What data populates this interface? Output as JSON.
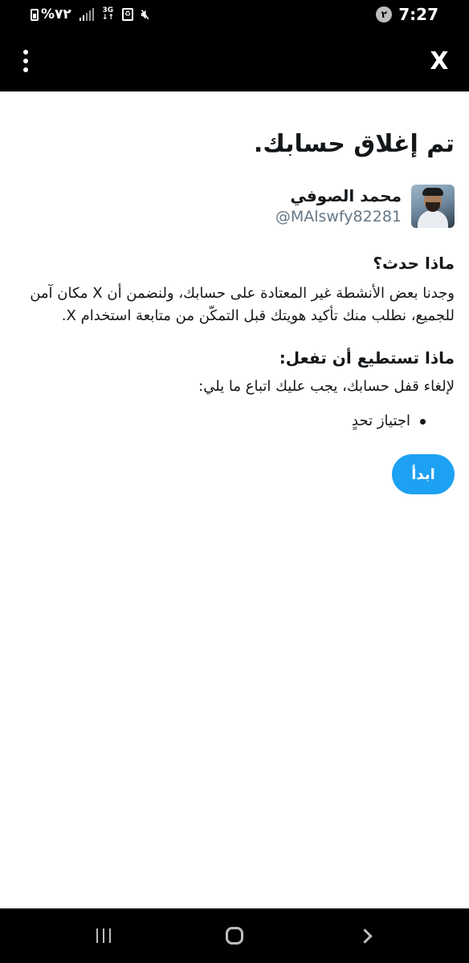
{
  "status_bar": {
    "battery_percent": "%٧٢",
    "network_label": "3G",
    "network_arrows": "↓↑",
    "notification_badge": "٢",
    "time": "7:27",
    "icons": [
      "battery-icon",
      "signal-icon",
      "network-3g-icon",
      "recycle-icon",
      "mute-icon",
      "notification-badge"
    ]
  },
  "header": {
    "menu_icon": "more-vertical-icon",
    "close_label": "X"
  },
  "main": {
    "title": "تم إغلاق حسابك.",
    "user": {
      "name": "محمد الصوفي",
      "handle": "@MAlswfy82281"
    },
    "what_happened": {
      "heading": "ماذا حدث؟",
      "text": "وجدنا بعض الأنشطة غير المعتادة على حسابك، ولنضمن أن X مكان آمن للجميع، نطلب منك تأكيد هويتك قبل التمكّن من متابعة استخدام X."
    },
    "what_you_can_do": {
      "heading": "ماذا تستطيع أن تفعل:",
      "text": "لإلغاء قفل حسابك، يجب عليك اتباع ما يلي:",
      "steps": [
        "اجتياز تحدٍ"
      ]
    },
    "start_button": "ابدأ"
  },
  "nav_bar": {
    "icons": [
      "recent-apps-icon",
      "home-icon",
      "back-icon"
    ]
  },
  "colors": {
    "accent": "#1da1f2",
    "text": "#14171a",
    "secondary_text": "#657786",
    "bars": "#000000"
  }
}
